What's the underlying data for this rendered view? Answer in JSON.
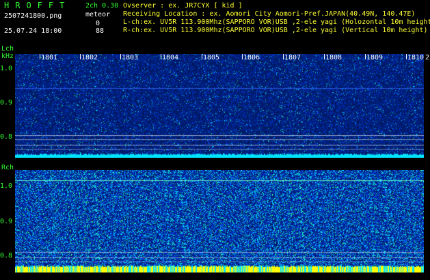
{
  "header": {
    "app_title": "HROFFT",
    "mode": "2ch 0.30",
    "filename": "2507241800.png",
    "meteor_label": "meteor",
    "lch_count": "0",
    "rch_count": "88",
    "datetime": "25.07.24 18:00"
  },
  "info": {
    "observer": "Ovserver           : ex. JR7CYX [ kid ]",
    "location": "Receiving Location : ex. Aomori City Aomori-Pref.JAPAN(40.49N, 140.47E)",
    "lch": "L-ch:ex. UV5R 113.900Mhz(SAPPORO VOR)USB ,2-ele yagi (Holozontal 10m height)",
    "rch": "R-ch:ex. UV5R 113.900Mhz(SAPPORO VOR)USB ,2-ele yagi (Vertical 10m height)"
  },
  "lch_panel": {
    "label": "Lch",
    "unit": "kHz",
    "yticks": [
      "1.0",
      "0.9",
      "0.8"
    ]
  },
  "rch_panel": {
    "label": "Rch",
    "yticks": [
      "1.0",
      "0.9",
      "0.8"
    ]
  },
  "time_axis": {
    "ticks": [
      "1801",
      "1802",
      "1803",
      "1804",
      "1805",
      "1806",
      "1807",
      "1808",
      "1809",
      "1810",
      "2"
    ]
  },
  "colors": {
    "label_green": "#33ff33",
    "background": "#000000",
    "noise_dark": "#001a66",
    "noise_mid": "#0033cc",
    "noise_cyan": "#00ccff",
    "noise_green": "#33ff99",
    "bottom_yellow": "#ffff00",
    "bottom_cyan": "#00e5ff"
  }
}
